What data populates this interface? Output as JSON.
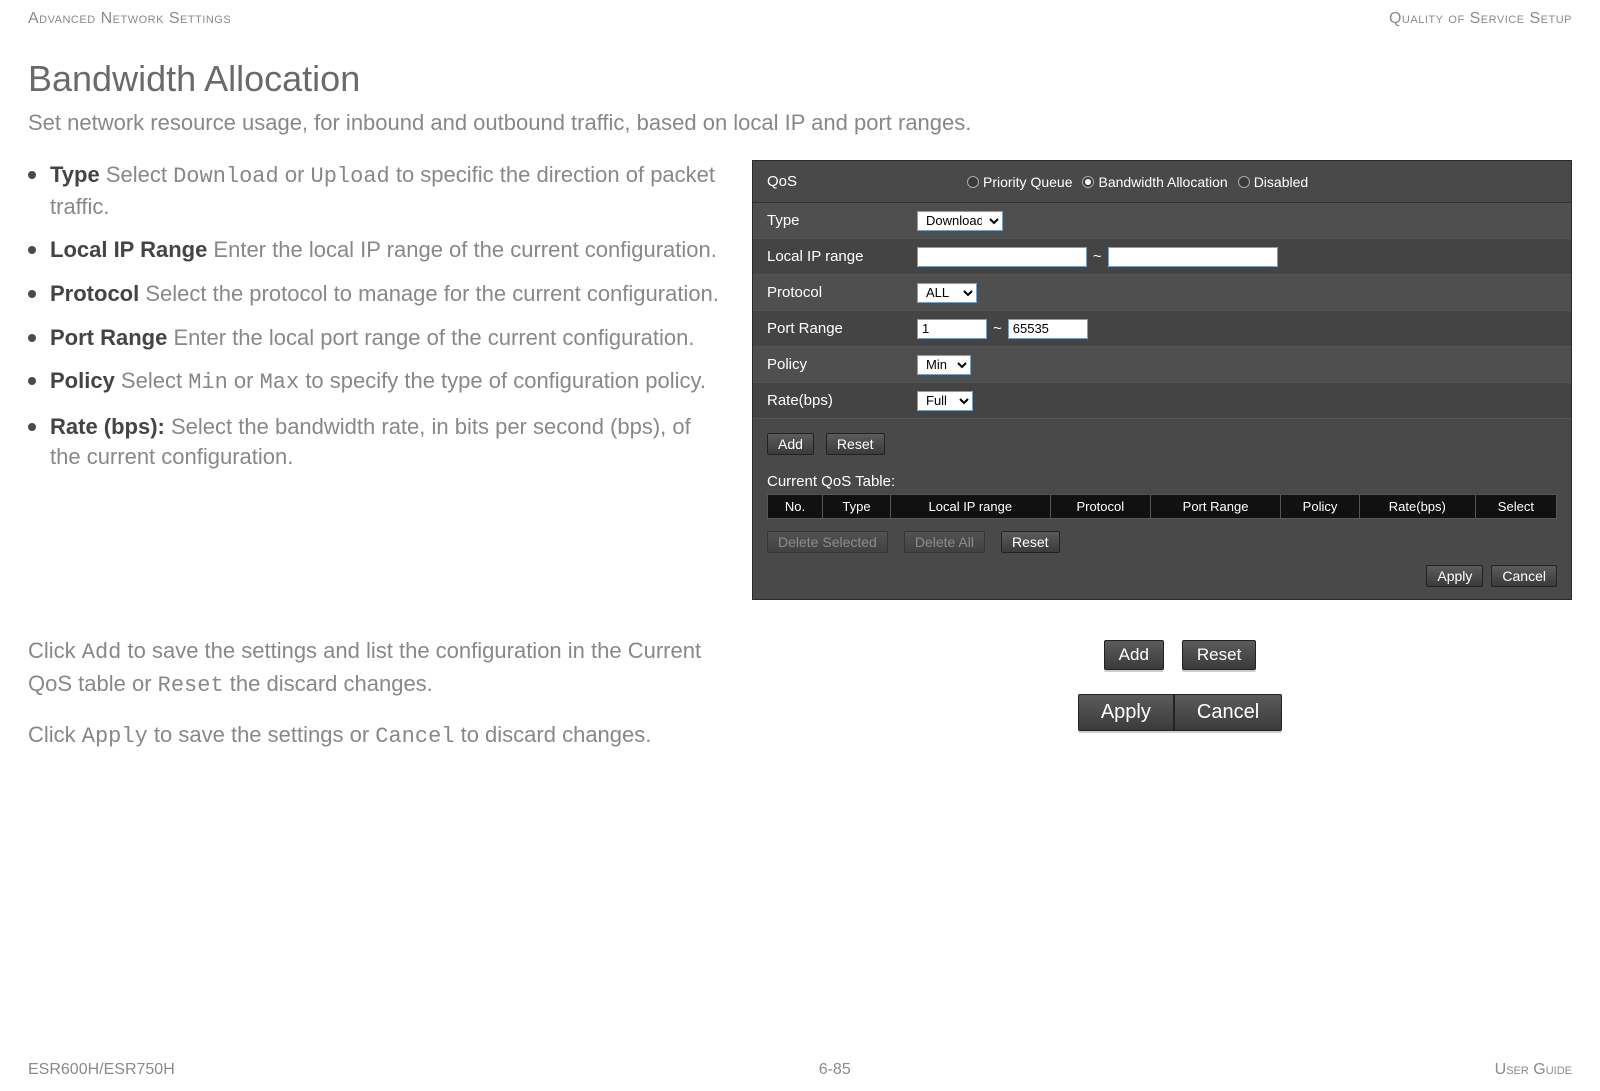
{
  "header": {
    "left": "Advanced Network Settings",
    "right": "Quality of Service Setup"
  },
  "section": {
    "title": "Bandwidth Allocation",
    "intro": "Set network resource usage, for inbound and outbound traffic, based on local IP and port ranges."
  },
  "bullets": {
    "type_label": "Type",
    "type_pre": "  Select ",
    "type_code1": "Download",
    "type_mid": " or ",
    "type_code2": "Upload",
    "type_post": " to specific the direction of packet traffic.",
    "lir_label": "Local IP Range",
    "lir_post": "  Enter the local IP range of the current configuration.",
    "proto_label": "Protocol",
    "proto_post": "  Select the protocol to manage for the current configuration.",
    "pr_label": "Port Range",
    "pr_post": "  Enter the local port range of the current configuration.",
    "pol_label": "Policy",
    "pol_pre": "  Select ",
    "pol_code1": "Min",
    "pol_mid": " or ",
    "pol_code2": "Max",
    "pol_post": " to specify the type of configuration policy.",
    "rate_label": "Rate (bps):",
    "rate_post": " Select the bandwidth rate, in bits per second (bps), of the current configuration."
  },
  "below": {
    "p1_a": "Click ",
    "p1_code1": "Add",
    "p1_b": " to save the settings and list the configuration in the Current QoS table or ",
    "p1_code2": "Reset",
    "p1_c": " the discard changes.",
    "p2_a": "Click ",
    "p2_code1": "Apply",
    "p2_b": " to save the settings or ",
    "p2_code2": "Cancel",
    "p2_c": " to discard changes."
  },
  "panel": {
    "qos_label": "QoS",
    "radio_priority": "Priority Queue",
    "radio_bw": "Bandwidth Allocation",
    "radio_disabled": "Disabled",
    "rows": {
      "type": "Type",
      "type_val": "Download",
      "lir": "Local IP range",
      "lir_from": "",
      "lir_to": "",
      "proto": "Protocol",
      "proto_val": "ALL",
      "pr": "Port Range",
      "pr_from": "1",
      "pr_to": "65535",
      "policy": "Policy",
      "policy_val": "Min",
      "rate": "Rate(bps)",
      "rate_val": "Full",
      "tilde": "~"
    },
    "buttons": {
      "add": "Add",
      "reset": "Reset",
      "delete_selected": "Delete Selected",
      "delete_all": "Delete All",
      "apply": "Apply",
      "cancel": "Cancel"
    },
    "table": {
      "title": "Current QoS Table:",
      "headers": [
        "No.",
        "Type",
        "Local IP range",
        "Protocol",
        "Port Range",
        "Policy",
        "Rate(bps)",
        "Select"
      ]
    }
  },
  "footer": {
    "left": "ESR600H/ESR750H",
    "center": "6-85",
    "right": "User Guide"
  }
}
